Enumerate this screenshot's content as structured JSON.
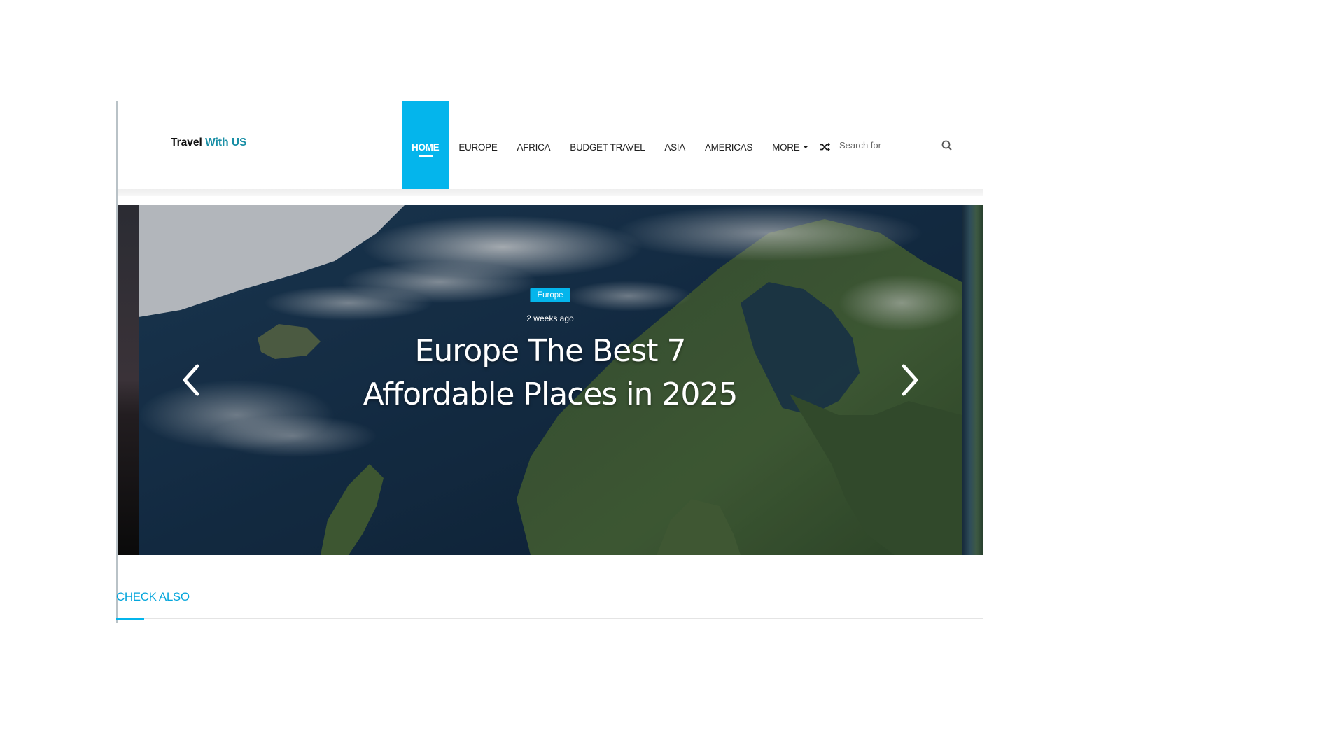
{
  "site": {
    "logo_part1": "Travel",
    "logo_part2": "With US"
  },
  "nav": {
    "items": [
      {
        "label": "HOME",
        "active": true
      },
      {
        "label": "EUROPE"
      },
      {
        "label": "AFRICA"
      },
      {
        "label": "BUDGET TRAVEL"
      },
      {
        "label": "ASIA"
      },
      {
        "label": "AMERICAS"
      },
      {
        "label": "MORE"
      }
    ],
    "random_icon": "shuffle-icon"
  },
  "search": {
    "placeholder": "Search for",
    "value": "",
    "icon": "search-icon"
  },
  "slider": {
    "category": "Europe",
    "date": "2 weeks ago",
    "title": "Europe The Best 7 Affordable Places in 2025",
    "prev_icon": "chevron-left-icon",
    "next_icon": "chevron-right-icon"
  },
  "check_also": {
    "label": "CHECK ALSO"
  },
  "colors": {
    "accent": "#04b5ec",
    "logo_accent": "#1a8fa6",
    "nav_text": "#1e1e1e"
  }
}
